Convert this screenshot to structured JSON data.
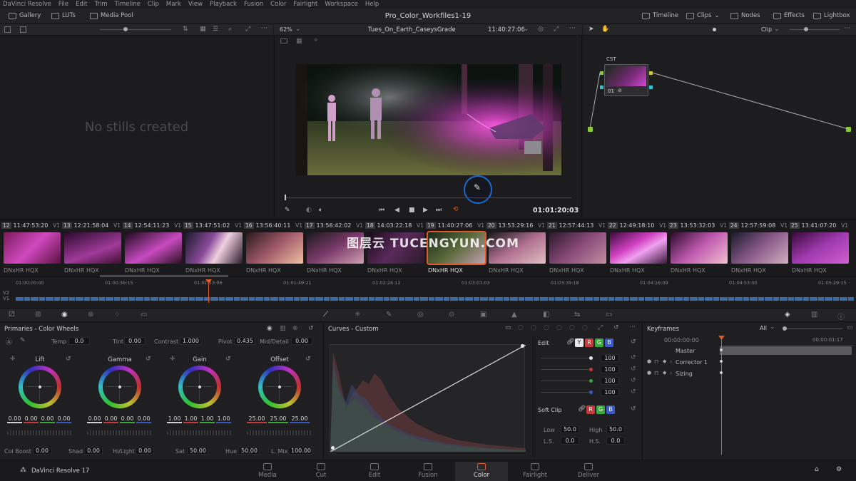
{
  "menu": [
    "DaVinci Resolve",
    "File",
    "Edit",
    "Trim",
    "Timeline",
    "Clip",
    "Mark",
    "View",
    "Playback",
    "Fusion",
    "Color",
    "Fairlight",
    "Workspace",
    "Help"
  ],
  "topbar": {
    "gallery": "Gallery",
    "luts": "LUTs",
    "media_pool": "Media Pool",
    "project_title": "Pro_Color_Workfiles1-19",
    "timeline": "Timeline",
    "clips": "Clips",
    "nodes": "Nodes",
    "effects": "Effects",
    "lightbox": "Lightbox"
  },
  "viewer": {
    "zoom": "62%",
    "clip_name": "Tues_On_Earth_CaseysGrade",
    "source_tc": "11:40:27:06",
    "record_tc": "01:01:20:03"
  },
  "nodes": {
    "mode": "Clip",
    "node_label": "CST",
    "node_number": "01"
  },
  "gallery": {
    "empty_text": "No stills created"
  },
  "clips": [
    {
      "num": "12",
      "tc": "11:47:53:20",
      "track": "V1",
      "codec": "DNxHR HQX"
    },
    {
      "num": "13",
      "tc": "12:21:58:04",
      "track": "V1",
      "codec": "DNxHR HQX"
    },
    {
      "num": "14",
      "tc": "12:54:11:23",
      "track": "V1",
      "codec": "DNxHR HQX"
    },
    {
      "num": "15",
      "tc": "13:47:51:02",
      "track": "V1",
      "codec": "DNxHR HQX"
    },
    {
      "num": "16",
      "tc": "13:56:40:11",
      "track": "V1",
      "codec": "DNxHR HQX"
    },
    {
      "num": "17",
      "tc": "13:56:42:02",
      "track": "V1",
      "codec": "DNxHR HQX"
    },
    {
      "num": "18",
      "tc": "14:03:22:18",
      "track": "V1",
      "codec": "DNxHR HQX"
    },
    {
      "num": "19",
      "tc": "11:40:27:06",
      "track": "V1",
      "codec": "DNxHR HQX"
    },
    {
      "num": "20",
      "tc": "13:53:29:16",
      "track": "V1",
      "codec": "DNxHR HQX"
    },
    {
      "num": "21",
      "tc": "12:57:44:13",
      "track": "V1",
      "codec": "DNxHR HQX"
    },
    {
      "num": "22",
      "tc": "12:49:18:10",
      "track": "V1",
      "codec": "DNxHR HQX"
    },
    {
      "num": "23",
      "tc": "13:53:32:03",
      "track": "V1",
      "codec": "DNxHR HQX"
    },
    {
      "num": "24",
      "tc": "12:57:59:08",
      "track": "V1",
      "codec": "DNxHR HQX"
    },
    {
      "num": "25",
      "tc": "13:41:07:20",
      "track": "V1",
      "codec": "DNxHR HQX"
    }
  ],
  "watermark": "图层云 TUCENGYUN.COM",
  "timeline_ruler": [
    "01:00:00:00",
    "01:00:36:15",
    "01:01:13:06",
    "01:01:49:21",
    "01:02:26:12",
    "01:03:03:03",
    "01:03:39:18",
    "01:04:16:09",
    "01:04:53:00",
    "01:05:29:15"
  ],
  "tracks": [
    "V2",
    "V1"
  ],
  "primaries": {
    "title": "Primaries - Color Wheels",
    "temp_label": "Temp",
    "temp": "0.0",
    "tint_label": "Tint",
    "tint": "0.00",
    "contrast_label": "Contrast",
    "contrast": "1.000",
    "pivot_label": "Pivot",
    "pivot": "0.435",
    "middetail_label": "Mid/Detail",
    "middetail": "0.00",
    "wheels": [
      {
        "name": "Lift",
        "values": [
          "0.00",
          "0.00",
          "0.00",
          "0.00"
        ]
      },
      {
        "name": "Gamma",
        "values": [
          "0.00",
          "0.00",
          "0.00",
          "0.00"
        ]
      },
      {
        "name": "Gain",
        "values": [
          "1.00",
          "1.00",
          "1.00",
          "1.00"
        ]
      },
      {
        "name": "Offset",
        "values": [
          "25.00",
          "25.00",
          "25.00"
        ]
      }
    ],
    "colboost_label": "Col Boost",
    "colboost": "0.00",
    "shad_label": "Shad",
    "shad": "0.00",
    "hilight_label": "Hi/Light",
    "hilight": "0.00",
    "sat_label": "Sat",
    "sat": "50.00",
    "hue_label": "Hue",
    "hue": "50.00",
    "lmix_label": "L. Mix",
    "lmix": "100.00"
  },
  "curves": {
    "title": "Curves - Custom",
    "edit_label": "Edit",
    "channels": [
      "Y",
      "R",
      "G",
      "B"
    ],
    "intensity": [
      "100",
      "100",
      "100",
      "100"
    ],
    "softclip_label": "Soft Clip",
    "low_label": "Low",
    "low": "50.0",
    "high_label": "High",
    "high": "50.0",
    "ls_label": "L.S.",
    "ls": "0.0",
    "hs_label": "H.S.",
    "hs": "0.0",
    "colors": {
      "y": "#e0e0e0",
      "r": "#c83a3a",
      "g": "#3aa83a",
      "b": "#3a5ac8"
    }
  },
  "keyframes": {
    "title": "Keyframes",
    "filter": "All",
    "tc_start": "00:00:00:00",
    "tc_end": "00:00:01:17",
    "rows": [
      "Master",
      "Corrector 1",
      "Sizing"
    ]
  },
  "pages": {
    "app_name": "DaVinci Resolve 17",
    "items": [
      "Media",
      "Cut",
      "Edit",
      "Fusion",
      "Color",
      "Fairlight",
      "Deliver"
    ],
    "active": "Color"
  },
  "accent": "#e05a2b"
}
